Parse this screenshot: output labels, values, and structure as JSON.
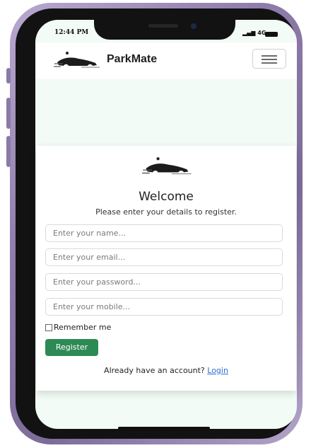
{
  "status_bar": {
    "time": "12:44 PM",
    "network": "4G"
  },
  "navbar": {
    "brand": "ParkMate",
    "logo_icon": "car-logo-icon",
    "menu_icon": "hamburger-menu-icon"
  },
  "register": {
    "logo_icon": "car-logo-icon",
    "title": "Welcome",
    "subtitle": "Please enter your details to register.",
    "fields": {
      "name_placeholder": "Enter your name...",
      "email_placeholder": "Enter your email...",
      "password_placeholder": "Enter your password...",
      "mobile_placeholder": "Enter your mobile..."
    },
    "remember_label": "Remember me",
    "submit_label": "Register",
    "login_prompt": "Already have an account?",
    "login_link": "Login"
  },
  "colors": {
    "accent": "#2e8a54",
    "link": "#2e6ed8",
    "background": "#f2fbf5",
    "device_frame": "#8e7caa"
  }
}
